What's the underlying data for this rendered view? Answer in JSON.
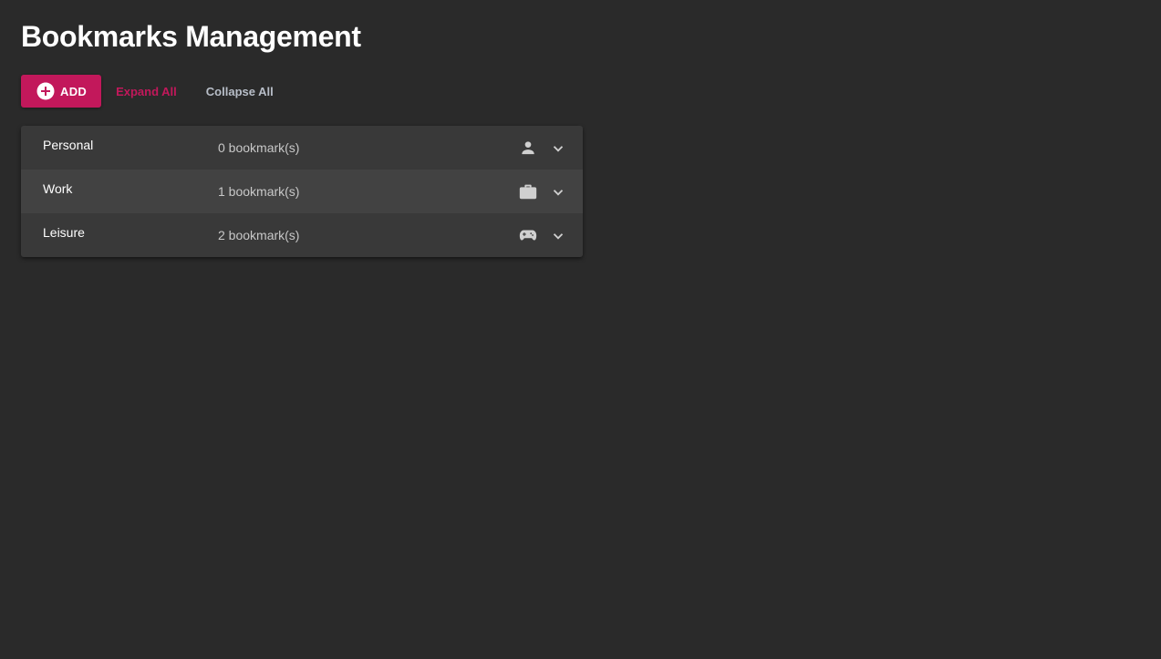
{
  "header": {
    "title": "Bookmarks Management"
  },
  "toolbar": {
    "add_label": "ADD",
    "add_icon": "plus-circle-icon",
    "expand_all_label": "Expand All",
    "collapse_all_label": "Collapse All"
  },
  "colors": {
    "background": "#2a2a2a",
    "accent": "#c2185b",
    "panel_row": "#393939",
    "panel_row_alt": "#424242"
  },
  "categories": [
    {
      "name": "Personal",
      "count_label": "0 bookmark(s)",
      "icon": "person-icon"
    },
    {
      "name": "Work",
      "count_label": "1 bookmark(s)",
      "icon": "briefcase-icon"
    },
    {
      "name": "Leisure",
      "count_label": "2 bookmark(s)",
      "icon": "gamepad-icon"
    }
  ]
}
